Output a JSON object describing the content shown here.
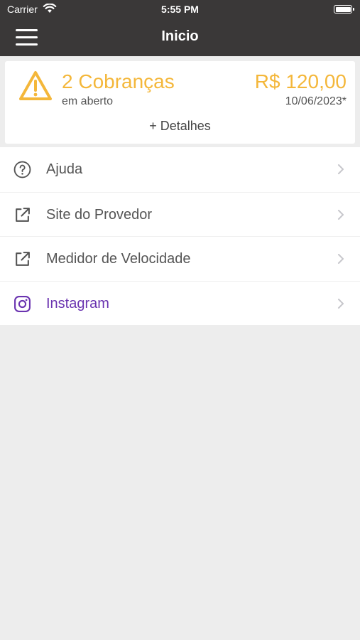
{
  "status_bar": {
    "carrier": "Carrier",
    "time": "5:55 PM"
  },
  "nav": {
    "title": "Inicio",
    "menu_icon": "hamburger-menu-icon"
  },
  "billing": {
    "count_text": "2 Cobranças",
    "subtitle": "em aberto",
    "amount": "R$ 120,00",
    "due_date": "10/06/2023*",
    "details_link": "+ Detalhes",
    "accent_color": "#f4b73a"
  },
  "menu_items": [
    {
      "label": "Ajuda",
      "icon": "help-circle-icon"
    },
    {
      "label": "Site do Provedor",
      "icon": "external-link-icon"
    },
    {
      "label": "Medidor de Velocidade",
      "icon": "external-link-icon"
    },
    {
      "label": "Instagram",
      "icon": "instagram-icon",
      "color": "#6a33b0"
    }
  ]
}
